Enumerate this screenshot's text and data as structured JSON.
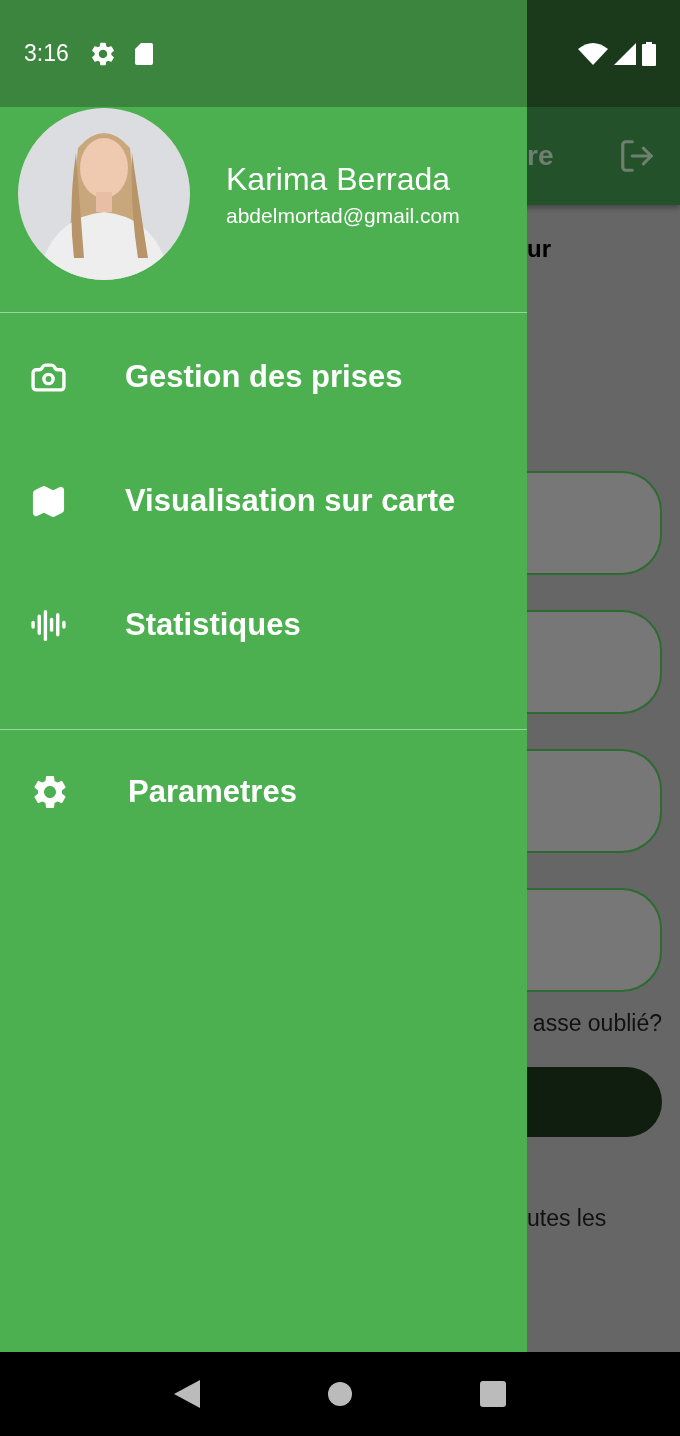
{
  "status_bar": {
    "time": "3:16"
  },
  "background_screen": {
    "app_bar_title": "re",
    "heading": "ur",
    "fields": [
      {
        "kind": "text-field"
      },
      {
        "kind": "text-field"
      },
      {
        "kind": "text-field"
      },
      {
        "kind": "text-field"
      }
    ],
    "forgot_link": "asse oublié?",
    "footer_text": "utes les"
  },
  "drawer": {
    "user": {
      "name": "Karima Berrada",
      "email": "abdelmortad@gmail.com"
    },
    "sections": [
      {
        "items": [
          {
            "kind": "camera",
            "label": "Gestion des prises"
          },
          {
            "kind": "map",
            "label": "Visualisation sur carte"
          },
          {
            "kind": "wave",
            "label": "Statistiques"
          }
        ]
      },
      {
        "items": [
          {
            "kind": "gear",
            "label": "Parametres"
          }
        ]
      }
    ]
  }
}
